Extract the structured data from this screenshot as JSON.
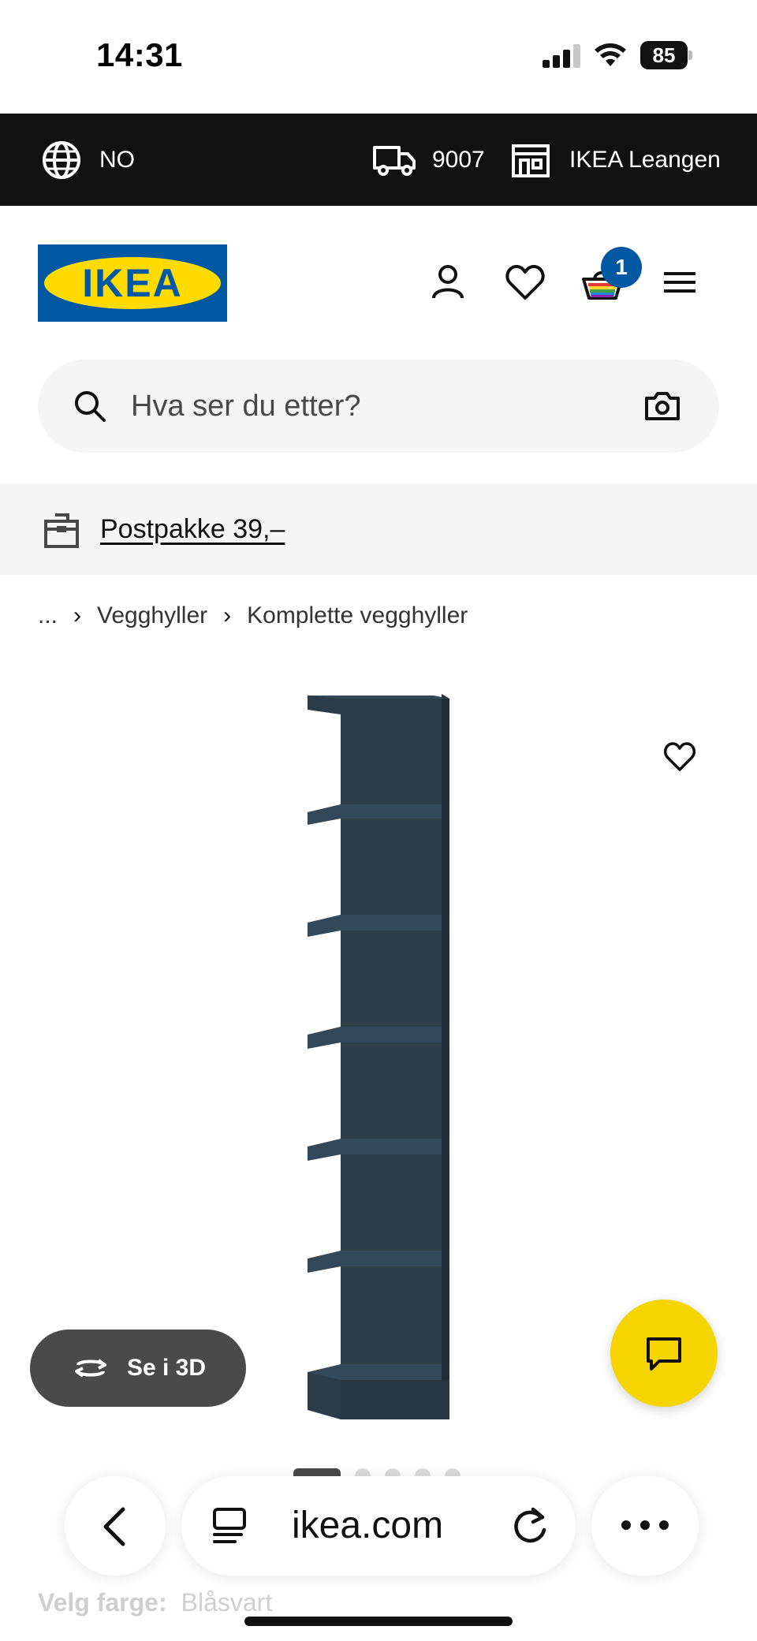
{
  "status_bar": {
    "time": "14:31",
    "battery": "85",
    "battery_level": 0.85
  },
  "topbar": {
    "language": "NO",
    "postcode": "9007",
    "store": "IKEA Leangen"
  },
  "header": {
    "logo_text": "IKEA",
    "cart_count": "1"
  },
  "search": {
    "placeholder": "Hva ser du etter?"
  },
  "promo": {
    "text": "Postpakke 39,–"
  },
  "breadcrumb": {
    "items": [
      "...",
      "Vegghyller",
      "Komplette vegghyller"
    ]
  },
  "product": {
    "see_3d": "Se i 3D",
    "color_label": "Velg farge:",
    "color_value": "Blåsvart"
  },
  "carousel": {
    "count": 5,
    "active": 1
  },
  "browser": {
    "url": "ikea.com"
  },
  "colors": {
    "ikea_blue": "#0058A3",
    "ikea_yellow": "#FFDB00",
    "shelf_color": "#2c3e4a",
    "chat_yellow": "#F5D400"
  },
  "icons": [
    "globe-icon",
    "truck-icon",
    "store-icon",
    "profile-icon",
    "heart-icon",
    "cart-icon",
    "menu-icon",
    "search-icon",
    "camera-icon",
    "parcel-icon",
    "rotate-3d-icon",
    "chat-icon",
    "back-icon",
    "reader-icon",
    "reload-icon",
    "more-icon"
  ]
}
